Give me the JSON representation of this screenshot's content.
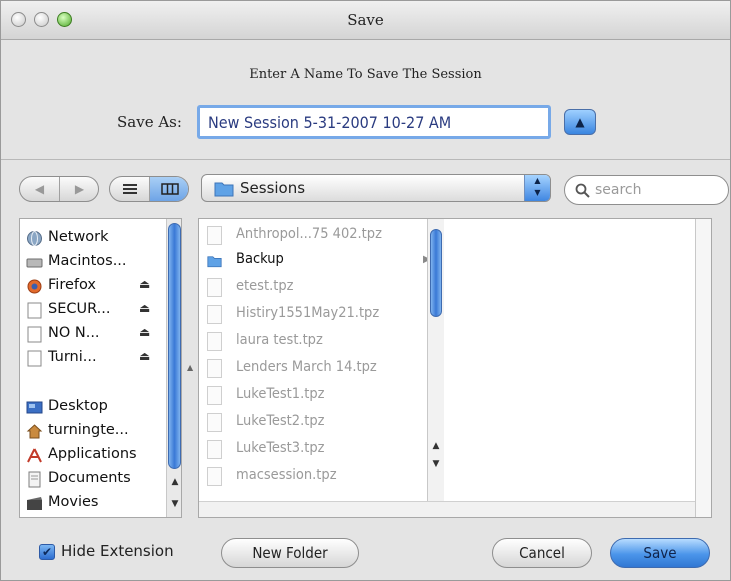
{
  "window": {
    "title": "Save"
  },
  "dialog": {
    "prompt": "Enter A Name To Save The Session",
    "save_as_label": "Save As:",
    "filename": "New Session 5-31-2007 10-27 AM"
  },
  "toolbar": {
    "location": "Sessions",
    "search_placeholder": "search"
  },
  "sidebar": {
    "devices": [
      {
        "label": "Network",
        "icon": "network-icon",
        "eject": false
      },
      {
        "label": "Macintos...",
        "icon": "hard-drive-icon",
        "eject": false
      },
      {
        "label": "Firefox",
        "icon": "firefox-disk-icon",
        "eject": true
      },
      {
        "label": "SECUR...",
        "icon": "volume-icon",
        "eject": true
      },
      {
        "label": "NO N...",
        "icon": "volume-icon",
        "eject": true
      },
      {
        "label": "Turni...",
        "icon": "volume-icon",
        "eject": true
      }
    ],
    "places": [
      {
        "label": "Desktop",
        "icon": "desktop-icon"
      },
      {
        "label": "turningte...",
        "icon": "home-icon"
      },
      {
        "label": "Applications",
        "icon": "applications-icon"
      },
      {
        "label": "Documents",
        "icon": "documents-icon"
      },
      {
        "label": "Movies",
        "icon": "movies-icon"
      }
    ]
  },
  "files": [
    {
      "name": "Anthropol...75 402.tpz",
      "folder": false
    },
    {
      "name": "Backup",
      "folder": true
    },
    {
      "name": "etest.tpz",
      "folder": false
    },
    {
      "name": "Histiry1551May21.tpz",
      "folder": false
    },
    {
      "name": "laura test.tpz",
      "folder": false
    },
    {
      "name": "Lenders March 14.tpz",
      "folder": false
    },
    {
      "name": "LukeTest1.tpz",
      "folder": false
    },
    {
      "name": "LukeTest2.tpz",
      "folder": false
    },
    {
      "name": "LukeTest3.tpz",
      "folder": false
    },
    {
      "name": "macsession.tpz",
      "folder": false
    }
  ],
  "footer": {
    "hide_extension_label": "Hide Extension",
    "hide_extension_checked": true,
    "new_folder_label": "New Folder",
    "cancel_label": "Cancel",
    "save_label": "Save"
  },
  "colors": {
    "accent": "#3b82e0",
    "folder": "#5fa2e6",
    "disabled_text": "#9a9a9a"
  }
}
